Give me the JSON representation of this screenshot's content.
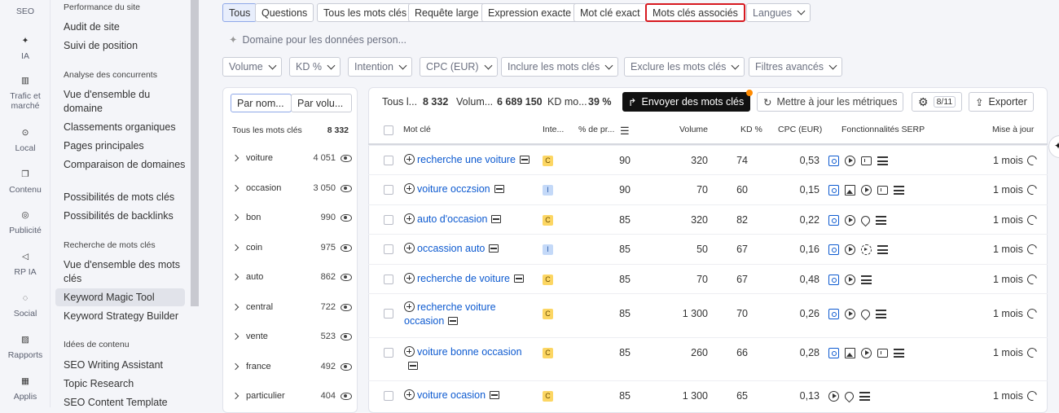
{
  "rail": [
    {
      "id": "seo",
      "label": "SEO",
      "icon": "search-icon"
    },
    {
      "id": "ia",
      "label": "IA",
      "icon": "sparkle-icon"
    },
    {
      "id": "trafic",
      "label": "Trafic et marché",
      "icon": "bar-chart-icon"
    },
    {
      "id": "local",
      "label": "Local",
      "icon": "map-pin-icon"
    },
    {
      "id": "contenu",
      "label": "Contenu",
      "icon": "document-icon"
    },
    {
      "id": "publicite",
      "label": "Publicité",
      "icon": "target-icon"
    },
    {
      "id": "rpia",
      "label": "RP IA",
      "icon": "megaphone-icon"
    },
    {
      "id": "social",
      "label": "Social",
      "icon": "chat-icon"
    },
    {
      "id": "rapports",
      "label": "Rapports",
      "icon": "report-icon"
    },
    {
      "id": "applis",
      "label": "Applis",
      "icon": "grid-icon"
    }
  ],
  "menu": {
    "sections": [
      "Performance du site",
      "Analyse des concurrents",
      "Recherche de mots clés",
      "Idées de contenu"
    ],
    "items": [
      "Audit de site",
      "Suivi de position",
      "Vue d'ensemble du domaine",
      "Classements organiques",
      "Pages principales",
      "Comparaison de domaines",
      "Possibilités de mots clés",
      "Possibilités de backlinks",
      "Vue d'ensemble des mots clés",
      "Keyword Magic Tool",
      "Keyword Strategy Builder",
      "SEO Writing Assistant",
      "Topic Research",
      "SEO Content Template"
    ]
  },
  "tabs": {
    "tous": "Tous",
    "questions": "Questions",
    "match": [
      "Tous les mots clés",
      "Requête large",
      "Expression exacte",
      "Mot clé exact",
      "Mots clés associés"
    ],
    "langues": "Langues"
  },
  "domain_placeholder": "Domaine pour les données person...",
  "filters": [
    "Volume",
    "KD %",
    "Intention",
    "CPC (EUR)",
    "Inclure les mots clés",
    "Exclure les mots clés",
    "Filtres avancés"
  ],
  "left": {
    "sort_name": "Par nom...",
    "sort_volume": "Par volu...",
    "all_label": "Tous les mots clés",
    "all_count": "8 332",
    "groups": [
      {
        "name": "voiture",
        "count": "4 051"
      },
      {
        "name": "occasion",
        "count": "3 050"
      },
      {
        "name": "bon",
        "count": "990"
      },
      {
        "name": "coin",
        "count": "975"
      },
      {
        "name": "auto",
        "count": "862"
      },
      {
        "name": "central",
        "count": "722"
      },
      {
        "name": "vente",
        "count": "523"
      },
      {
        "name": "france",
        "count": "492"
      },
      {
        "name": "particulier",
        "count": "404"
      }
    ]
  },
  "summary": {
    "all_label": "Tous l...",
    "all_value": "8 332",
    "volume_label": "Volum...",
    "volume_value": "6 689 150",
    "kd_label": "KD mo...",
    "kd_value": "39 %",
    "send_button": "Envoyer des mots clés",
    "update_button": "Mettre à jour les métriques",
    "settings_badge": "8/11",
    "export_button": "Exporter"
  },
  "columns": {
    "keyword": "Mot clé",
    "intent": "Inte...",
    "pct": "% de pr...",
    "volume": "Volume",
    "kd": "KD %",
    "cpc": "CPC (EUR)",
    "serp": "Fonctionnalités SERP",
    "update": "Mise à jour"
  },
  "rows": [
    {
      "keyword": "recherche une voiture",
      "intent": "C",
      "pct": "90",
      "volume": "320",
      "kd": "74",
      "cpc": "0,53",
      "features": [
        "q",
        "play",
        "cmt",
        "list"
      ],
      "update": "1 mois"
    },
    {
      "keyword": "voiture occzsion",
      "intent": "I",
      "pct": "90",
      "volume": "70",
      "kd": "60",
      "cpc": "0,15",
      "features": [
        "q",
        "img",
        "play",
        "cmt",
        "list"
      ],
      "update": "1 mois"
    },
    {
      "keyword": "auto d'occasion",
      "intent": "C",
      "pct": "85",
      "volume": "320",
      "kd": "82",
      "cpc": "0,22",
      "features": [
        "q",
        "play",
        "pin",
        "list"
      ],
      "update": "1 mois"
    },
    {
      "keyword": "occassion auto",
      "intent": "I",
      "pct": "85",
      "volume": "50",
      "kd": "67",
      "cpc": "0,16",
      "features": [
        "q",
        "play",
        "clock",
        "list"
      ],
      "update": "1 mois"
    },
    {
      "keyword": "recherche de voiture",
      "intent": "C",
      "pct": "85",
      "volume": "70",
      "kd": "67",
      "cpc": "0,48",
      "features": [
        "q",
        "play",
        "list"
      ],
      "update": "1 mois"
    },
    {
      "keyword": "recherche voiture occasion",
      "intent": "C",
      "pct": "85",
      "volume": "1 300",
      "kd": "70",
      "cpc": "0,26",
      "features": [
        "q",
        "play",
        "pin",
        "list"
      ],
      "update": "1 mois"
    },
    {
      "keyword": "voiture bonne occasion",
      "intent": "C",
      "pct": "85",
      "volume": "260",
      "kd": "66",
      "cpc": "0,28",
      "features": [
        "q",
        "img",
        "play",
        "cmt",
        "list"
      ],
      "update": "1 mois"
    },
    {
      "keyword": "voiture ocasion",
      "intent": "C",
      "pct": "85",
      "volume": "1 300",
      "kd": "65",
      "cpc": "0,13",
      "features": [
        "play",
        "pin",
        "list"
      ],
      "update": "1 mois"
    }
  ]
}
